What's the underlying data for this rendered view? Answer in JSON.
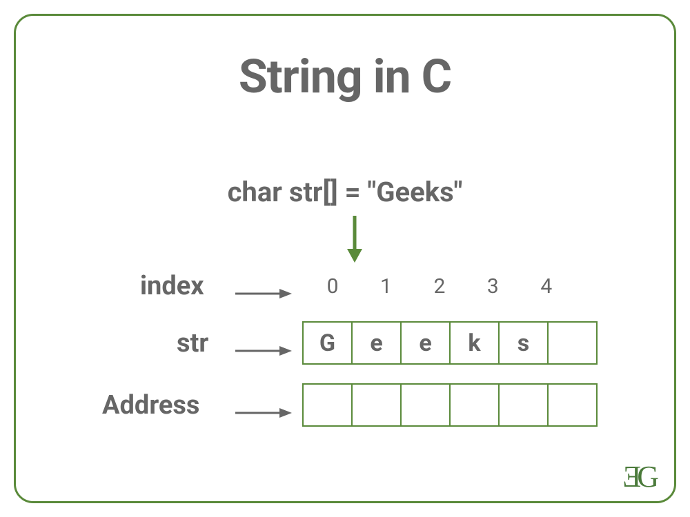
{
  "title": "String in C",
  "declaration": "char str[] = \"Geeks\"",
  "labels": {
    "index": "index",
    "str": "str",
    "address": "Address"
  },
  "index_values": [
    "0",
    "1",
    "2",
    "3",
    "4"
  ],
  "str_cells": [
    "G",
    "e",
    "e",
    "k",
    "s",
    ""
  ],
  "address_cells": [
    "",
    "",
    "",
    "",
    "",
    ""
  ],
  "logo": "ƎG",
  "colors": {
    "border_green": "#5a8a3a",
    "text_gray": "#666666",
    "logo_green": "#4a7a3a"
  }
}
